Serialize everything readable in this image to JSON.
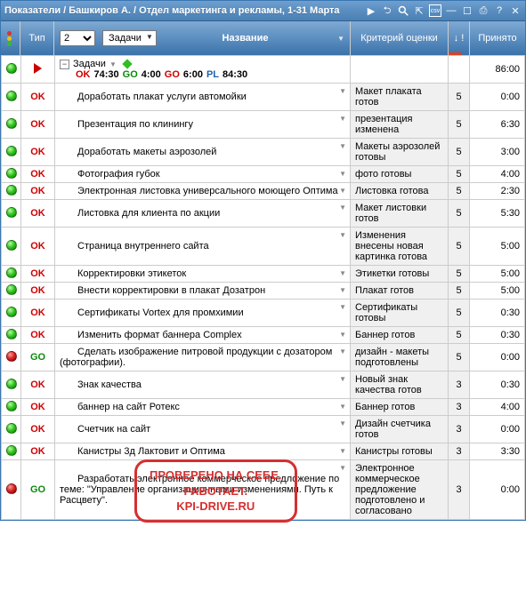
{
  "titlebar": {
    "title": "Показатели / Башкиров А. / Отдел маркетинга и рекламы, 1-31 Марта"
  },
  "header": {
    "type_label": "Тип",
    "level_value": "2",
    "tasks_button": "Задачи",
    "name_label": "Название",
    "crit_label": "Критерий оценки",
    "arrow_label": "↓ !",
    "accepted_label": "Принято"
  },
  "summary": {
    "title": "Задачи",
    "stats": [
      {
        "lbl": "OK",
        "cls": "red",
        "val": "74:30"
      },
      {
        "lbl": "GO",
        "cls": "green",
        "val": "4:00"
      },
      {
        "lbl": "GO",
        "cls": "red",
        "val": "6:00"
      },
      {
        "lbl": "PL",
        "cls": "blue",
        "val": "84:30"
      }
    ],
    "time": "86:00"
  },
  "rows": [
    {
      "light": "green",
      "type": "OK",
      "name": "Доработать плакат услуги автомойки",
      "crit": "Макет плаката готов",
      "n": "5",
      "time": "0:00"
    },
    {
      "light": "green",
      "type": "OK",
      "name": "Презентация по клинингу",
      "crit": "презентация изменена",
      "n": "5",
      "time": "6:30"
    },
    {
      "light": "green",
      "type": "OK",
      "name": "Доработать макеты аэрозолей",
      "crit": "Макеты аэрозолей готовы",
      "n": "5",
      "time": "3:00"
    },
    {
      "light": "green",
      "type": "OK",
      "name": "Фотография губок",
      "crit": "фото готовы",
      "n": "5",
      "time": "4:00"
    },
    {
      "light": "green",
      "type": "OK",
      "name": "Электронная листовка универсального моющего Оптима",
      "crit": "Листовка готова",
      "n": "5",
      "time": "2:30"
    },
    {
      "light": "green",
      "type": "OK",
      "name": "Листовка для клиента по акции",
      "crit": "Макет листовки готов",
      "n": "5",
      "time": "5:30"
    },
    {
      "light": "green",
      "type": "OK",
      "name": "Страница внутреннего сайта",
      "crit": "Изменения внесены новая картинка готова",
      "n": "5",
      "time": "5:00"
    },
    {
      "light": "green",
      "type": "OK",
      "name": "Корректировки этикеток",
      "crit": "Этикетки готовы",
      "n": "5",
      "time": "5:00"
    },
    {
      "light": "green",
      "type": "OK",
      "name": "Внести корректировки в плакат Дозатрон",
      "crit": "Плакат готов",
      "n": "5",
      "time": "5:00"
    },
    {
      "light": "green",
      "type": "OK",
      "name": "Сертификаты Vortex для промхимии",
      "crit": "Сертификаты готовы",
      "n": "5",
      "time": "0:30"
    },
    {
      "light": "green",
      "type": "OK",
      "name": "Изменить формат баннера Complex",
      "crit": "Баннер готов",
      "n": "5",
      "time": "0:30"
    },
    {
      "light": "red",
      "type": "GO",
      "name": "Сделать изображение питровой продукции с дозатором (фотографии).",
      "crit": "дизайн - макеты подготовлены",
      "n": "5",
      "time": "0:00"
    },
    {
      "light": "green",
      "type": "OK",
      "name": "Знак качества",
      "crit": "Новый знак качества готов",
      "n": "3",
      "time": "0:30"
    },
    {
      "light": "green",
      "type": "OK",
      "name": "баннер на сайт Ротекс",
      "crit": "Баннер готов",
      "n": "3",
      "time": "4:00"
    },
    {
      "light": "green",
      "type": "OK",
      "name": "Счетчик на сайт",
      "crit": "Дизайн счетчика готов",
      "n": "3",
      "time": "0:00"
    },
    {
      "light": "green",
      "type": "OK",
      "name": "Канистры 3д Лактовит и Оптима",
      "crit": "Канистры готовы",
      "n": "3",
      "time": "3:30"
    },
    {
      "light": "red",
      "type": "GO",
      "name": "Разработать электронное коммерческое предложение по теме: \"Управление организационными изменениями. Путь к Расцвету\".",
      "crit": "Электронное коммерческое предложение подготовлено и согласовано",
      "n": "3",
      "time": "0:00"
    }
  ],
  "stamp": {
    "line1": "ПРОВЕРЕНО НА СЕБЕ.",
    "line2": "РАБОТАЕТ.",
    "line3": "KPI-DRIVE.RU"
  }
}
